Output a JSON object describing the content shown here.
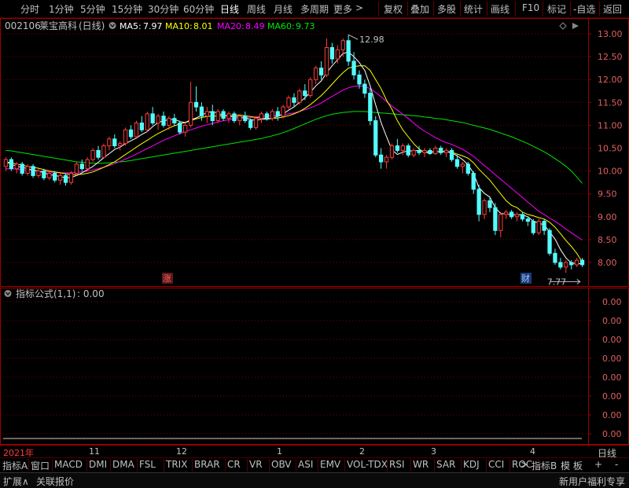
{
  "toolbar": {
    "periods": [
      "分时",
      "1分钟",
      "5分钟",
      "15分钟",
      "30分钟",
      "60分钟",
      "日线",
      "周线",
      "月线",
      "多周期",
      "更多"
    ],
    "active_period": "日线",
    "more_arrow": ">",
    "right_buttons": [
      "复权",
      "叠加",
      "多股",
      "统计",
      "画线",
      "F10",
      "标记",
      "-自选",
      "返回"
    ]
  },
  "header": {
    "code": "002106",
    "name": "莱宝高科",
    "period_label": "(日线)",
    "ma5_label": "MA5:",
    "ma5_value": "7.97",
    "ma10_label": "MA10:",
    "ma10_value": "8.01",
    "ma20_label": "MA20:",
    "ma20_value": "8.49",
    "ma60_label": "MA60:",
    "ma60_value": "9.73"
  },
  "colors": {
    "up": "#ff3c3c",
    "down": "#54fcfc",
    "ma5": "#ffffff",
    "ma10": "#ffff00",
    "ma20": "#ff00ff",
    "ma60": "#00e600",
    "frame": "#a00000"
  },
  "indicator": {
    "title": "指标公式(1,1)",
    "value": ": 0.00"
  },
  "chart_data": {
    "type": "candlestick",
    "y_ticks": [
      13.0,
      12.5,
      12.0,
      11.5,
      11.0,
      10.5,
      10.0,
      9.5,
      9.0,
      8.5,
      8.0
    ],
    "ylim": [
      7.65,
      13.15
    ],
    "high_marker": "12.98",
    "low_marker": "7.77",
    "markers": [
      "涨",
      "财"
    ],
    "x_labels": [
      "2021年",
      "11",
      "12",
      "1",
      "2",
      "3",
      "4"
    ],
    "ohlc": [
      [
        10.1,
        10.3,
        10.0,
        10.25
      ],
      [
        10.25,
        10.3,
        10.0,
        10.05
      ],
      [
        10.05,
        10.2,
        9.95,
        10.15
      ],
      [
        10.15,
        10.2,
        9.9,
        9.95
      ],
      [
        9.95,
        10.15,
        9.9,
        10.1
      ],
      [
        10.1,
        10.15,
        9.85,
        9.9
      ],
      [
        9.9,
        10.05,
        9.85,
        10.0
      ],
      [
        10.0,
        10.05,
        9.8,
        9.85
      ],
      [
        9.85,
        10.0,
        9.8,
        9.95
      ],
      [
        9.95,
        10.0,
        9.75,
        9.8
      ],
      [
        9.8,
        9.95,
        9.7,
        9.9
      ],
      [
        9.9,
        9.95,
        9.68,
        9.75
      ],
      [
        9.75,
        10.0,
        9.7,
        9.95
      ],
      [
        9.95,
        10.2,
        9.9,
        10.15
      ],
      [
        10.15,
        10.25,
        10.0,
        10.05
      ],
      [
        10.05,
        10.3,
        10.0,
        10.25
      ],
      [
        10.25,
        10.5,
        10.2,
        10.45
      ],
      [
        10.45,
        10.55,
        10.25,
        10.3
      ],
      [
        10.3,
        10.6,
        10.28,
        10.55
      ],
      [
        10.55,
        10.75,
        10.45,
        10.7
      ],
      [
        10.7,
        10.8,
        10.5,
        10.55
      ],
      [
        10.55,
        10.65,
        10.45,
        10.6
      ],
      [
        10.6,
        10.95,
        10.55,
        10.9
      ],
      [
        10.9,
        11.0,
        10.7,
        10.75
      ],
      [
        10.75,
        11.1,
        10.7,
        11.05
      ],
      [
        11.05,
        11.2,
        10.85,
        10.9
      ],
      [
        10.9,
        11.3,
        10.85,
        11.25
      ],
      [
        11.25,
        11.4,
        11.0,
        11.05
      ],
      [
        11.05,
        11.25,
        10.9,
        11.2
      ],
      [
        11.2,
        11.3,
        10.95,
        11.0
      ],
      [
        11.0,
        11.2,
        10.9,
        11.15
      ],
      [
        11.15,
        11.25,
        11.0,
        11.05
      ],
      [
        11.05,
        11.1,
        10.8,
        10.85
      ],
      [
        10.85,
        11.05,
        10.75,
        11.0
      ],
      [
        11.0,
        11.95,
        10.95,
        11.5
      ],
      [
        11.5,
        11.85,
        11.3,
        11.4
      ],
      [
        11.4,
        11.5,
        11.1,
        11.2
      ],
      [
        11.2,
        11.4,
        11.05,
        11.3
      ],
      [
        11.3,
        11.45,
        11.0,
        11.1
      ],
      [
        11.1,
        11.35,
        11.05,
        11.3
      ],
      [
        11.3,
        11.35,
        11.1,
        11.15
      ],
      [
        11.15,
        11.3,
        11.05,
        11.25
      ],
      [
        11.25,
        11.3,
        11.05,
        11.1
      ],
      [
        11.1,
        11.25,
        11.0,
        11.2
      ],
      [
        11.2,
        11.3,
        11.05,
        11.1
      ],
      [
        11.1,
        11.15,
        10.9,
        10.95
      ],
      [
        10.95,
        11.2,
        10.9,
        11.15
      ],
      [
        11.15,
        11.3,
        11.05,
        11.25
      ],
      [
        11.25,
        11.3,
        11.1,
        11.15
      ],
      [
        11.15,
        11.35,
        11.1,
        11.3
      ],
      [
        11.3,
        11.4,
        11.1,
        11.2
      ],
      [
        11.2,
        11.45,
        11.15,
        11.4
      ],
      [
        11.4,
        11.65,
        11.35,
        11.6
      ],
      [
        11.6,
        11.7,
        11.4,
        11.5
      ],
      [
        11.5,
        11.8,
        11.45,
        11.75
      ],
      [
        11.75,
        11.9,
        11.55,
        11.65
      ],
      [
        11.65,
        12.05,
        11.6,
        12.0
      ],
      [
        12.0,
        12.3,
        11.9,
        12.25
      ],
      [
        12.25,
        12.4,
        12.0,
        12.1
      ],
      [
        12.1,
        12.9,
        12.05,
        12.7
      ],
      [
        12.7,
        12.8,
        12.35,
        12.45
      ],
      [
        12.45,
        12.75,
        12.35,
        12.65
      ],
      [
        12.65,
        12.9,
        12.5,
        12.85
      ],
      [
        12.85,
        12.98,
        12.3,
        12.4
      ],
      [
        12.4,
        12.6,
        12.0,
        12.1
      ],
      [
        12.1,
        12.2,
        11.8,
        11.9
      ],
      [
        11.9,
        12.0,
        11.6,
        11.7
      ],
      [
        11.7,
        11.8,
        11.0,
        11.1
      ],
      [
        11.1,
        11.2,
        10.3,
        10.35
      ],
      [
        10.35,
        10.5,
        10.05,
        10.2
      ],
      [
        10.2,
        10.35,
        10.05,
        10.3
      ],
      [
        10.3,
        10.6,
        10.25,
        10.55
      ],
      [
        10.55,
        10.7,
        10.4,
        10.45
      ],
      [
        10.45,
        10.6,
        10.35,
        10.55
      ],
      [
        10.55,
        10.6,
        10.3,
        10.35
      ],
      [
        10.35,
        10.5,
        10.3,
        10.45
      ],
      [
        10.45,
        10.55,
        10.35,
        10.4
      ],
      [
        10.4,
        10.5,
        10.3,
        10.45
      ],
      [
        10.45,
        10.5,
        10.35,
        10.38
      ],
      [
        10.38,
        10.55,
        10.35,
        10.5
      ],
      [
        10.5,
        10.55,
        10.35,
        10.4
      ],
      [
        10.4,
        10.5,
        10.3,
        10.45
      ],
      [
        10.45,
        10.5,
        10.2,
        10.25
      ],
      [
        10.25,
        10.35,
        10.05,
        10.1
      ],
      [
        10.1,
        10.2,
        9.95,
        10.15
      ],
      [
        10.15,
        10.2,
        9.9,
        9.95
      ],
      [
        9.95,
        10.0,
        9.5,
        9.6
      ],
      [
        9.6,
        9.7,
        8.9,
        9.05
      ],
      [
        9.05,
        9.4,
        8.95,
        9.35
      ],
      [
        9.35,
        9.45,
        9.1,
        9.2
      ],
      [
        9.2,
        9.3,
        8.6,
        8.7
      ],
      [
        8.7,
        9.1,
        8.55,
        9.05
      ],
      [
        9.05,
        9.15,
        8.95,
        9.1
      ],
      [
        9.1,
        9.15,
        8.95,
        9.0
      ],
      [
        9.0,
        9.1,
        8.9,
        9.05
      ],
      [
        9.05,
        9.1,
        8.9,
        8.95
      ],
      [
        8.95,
        9.0,
        8.8,
        8.9
      ],
      [
        8.9,
        8.95,
        8.6,
        8.65
      ],
      [
        8.65,
        8.95,
        8.6,
        8.9
      ],
      [
        8.9,
        8.95,
        8.6,
        8.7
      ],
      [
        8.7,
        8.75,
        8.15,
        8.2
      ],
      [
        8.2,
        8.3,
        7.95,
        8.0
      ],
      [
        8.0,
        8.1,
        7.85,
        7.9
      ],
      [
        7.9,
        8.05,
        7.77,
        8.0
      ],
      [
        8.0,
        8.05,
        7.85,
        7.95
      ],
      [
        7.95,
        8.1,
        7.9,
        8.05
      ],
      [
        8.05,
        8.1,
        7.9,
        7.95
      ]
    ],
    "ma5": [
      10.2,
      10.15,
      10.1,
      10.08,
      10.05,
      10.02,
      10.0,
      9.96,
      9.92,
      9.9,
      9.88,
      9.85,
      9.86,
      9.9,
      9.96,
      10.03,
      10.1,
      10.19,
      10.29,
      10.38,
      10.47,
      10.52,
      10.6,
      10.66,
      10.72,
      10.8,
      10.86,
      10.97,
      11.06,
      11.1,
      11.12,
      11.13,
      11.08,
      11.06,
      11.12,
      11.16,
      11.22,
      11.28,
      11.3,
      11.26,
      11.22,
      11.2,
      11.18,
      11.18,
      11.17,
      11.12,
      11.11,
      11.13,
      11.13,
      11.15,
      11.2,
      11.25,
      11.33,
      11.4,
      11.5,
      11.6,
      11.72,
      11.86,
      11.97,
      12.15,
      12.3,
      12.43,
      12.57,
      12.6,
      12.5,
      12.37,
      12.2,
      11.86,
      11.45,
      11.06,
      10.75,
      10.46,
      10.36,
      10.41,
      10.44,
      10.44,
      10.45,
      10.42,
      10.42,
      10.42,
      10.43,
      10.42,
      10.4,
      10.33,
      10.25,
      10.14,
      9.95,
      9.64,
      9.51,
      9.43,
      9.2,
      9.07,
      9.06,
      9.04,
      9.05,
      9.04,
      9.0,
      8.9,
      8.86,
      8.82,
      8.67,
      8.51,
      8.28,
      8.1,
      7.99,
      7.98,
      7.97
    ],
    "ma10": [
      10.2,
      10.18,
      10.15,
      10.13,
      10.1,
      10.08,
      10.06,
      10.03,
      10.0,
      9.98,
      9.96,
      9.94,
      9.92,
      9.92,
      9.93,
      9.95,
      9.98,
      10.03,
      10.08,
      10.14,
      10.2,
      10.28,
      10.36,
      10.44,
      10.52,
      10.6,
      10.67,
      10.75,
      10.82,
      10.88,
      10.94,
      10.99,
      11.03,
      11.06,
      11.1,
      11.14,
      11.17,
      11.19,
      11.2,
      11.2,
      11.21,
      11.21,
      11.22,
      11.22,
      11.21,
      11.19,
      11.17,
      11.16,
      11.15,
      11.15,
      11.16,
      11.18,
      11.21,
      11.25,
      11.3,
      11.37,
      11.45,
      11.55,
      11.65,
      11.77,
      11.9,
      12.03,
      12.15,
      12.25,
      12.28,
      12.3,
      12.3,
      12.2,
      12.0,
      11.8,
      11.55,
      11.35,
      11.1,
      10.9,
      10.75,
      10.6,
      10.48,
      10.4,
      10.41,
      10.42,
      10.43,
      10.43,
      10.41,
      10.37,
      10.33,
      10.28,
      10.18,
      10.04,
      9.92,
      9.8,
      9.65,
      9.5,
      9.35,
      9.25,
      9.2,
      9.1,
      9.05,
      9.02,
      8.98,
      8.95,
      8.88,
      8.77,
      8.63,
      8.48,
      8.35,
      8.2,
      8.01
    ],
    "ma20": [
      10.05,
      10.05,
      10.04,
      10.03,
      10.02,
      10.01,
      10.0,
      9.99,
      9.98,
      9.97,
      9.96,
      9.96,
      9.96,
      9.97,
      9.98,
      10.0,
      10.02,
      10.05,
      10.08,
      10.12,
      10.16,
      10.21,
      10.26,
      10.31,
      10.37,
      10.43,
      10.49,
      10.55,
      10.61,
      10.67,
      10.72,
      10.77,
      10.82,
      10.86,
      10.9,
      10.94,
      10.98,
      11.01,
      11.04,
      11.07,
      11.1,
      11.12,
      11.14,
      11.15,
      11.16,
      11.17,
      11.18,
      11.19,
      11.2,
      11.21,
      11.22,
      11.23,
      11.25,
      11.27,
      11.3,
      11.34,
      11.38,
      11.43,
      11.49,
      11.56,
      11.63,
      11.7,
      11.77,
      11.82,
      11.85,
      11.86,
      11.85,
      11.8,
      11.72,
      11.62,
      11.52,
      11.42,
      11.33,
      11.24,
      11.15,
      11.05,
      10.95,
      10.87,
      10.8,
      10.73,
      10.67,
      10.62,
      10.58,
      10.53,
      10.47,
      10.4,
      10.32,
      10.22,
      10.12,
      10.02,
      9.92,
      9.82,
      9.72,
      9.62,
      9.52,
      9.42,
      9.32,
      9.22,
      9.12,
      9.05,
      8.97,
      8.9,
      8.82,
      8.73,
      8.65,
      8.57,
      8.49
    ],
    "ma60": [
      10.45,
      10.44,
      10.42,
      10.4,
      10.38,
      10.36,
      10.34,
      10.32,
      10.3,
      10.28,
      10.26,
      10.24,
      10.22,
      10.2,
      10.19,
      10.18,
      10.17,
      10.17,
      10.17,
      10.18,
      10.19,
      10.2,
      10.21,
      10.23,
      10.25,
      10.27,
      10.29,
      10.31,
      10.33,
      10.35,
      10.37,
      10.39,
      10.41,
      10.43,
      10.45,
      10.47,
      10.49,
      10.51,
      10.53,
      10.55,
      10.57,
      10.59,
      10.61,
      10.63,
      10.65,
      10.67,
      10.69,
      10.71,
      10.74,
      10.77,
      10.8,
      10.84,
      10.88,
      10.93,
      10.98,
      11.03,
      11.08,
      11.13,
      11.17,
      11.21,
      11.24,
      11.26,
      11.28,
      11.29,
      11.3,
      11.3,
      11.3,
      11.29,
      11.28,
      11.27,
      11.26,
      11.25,
      11.24,
      11.23,
      11.22,
      11.21,
      11.2,
      11.18,
      11.17,
      11.15,
      11.14,
      11.12,
      11.1,
      11.08,
      11.06,
      11.03,
      11.0,
      10.97,
      10.94,
      10.91,
      10.87,
      10.83,
      10.79,
      10.75,
      10.7,
      10.65,
      10.6,
      10.54,
      10.48,
      10.42,
      10.35,
      10.27,
      10.19,
      10.1,
      10.0,
      9.87,
      9.73
    ],
    "indicator_y_ticks": [
      "0.00",
      "0.00",
      "0.00",
      "0.00",
      "0.00",
      "0.00",
      "0.00",
      "0.00"
    ]
  },
  "xaxis": {
    "period_button": "日线"
  },
  "tabs": [
    "指标A",
    "窗口",
    "MACD",
    "DMI",
    "DMA",
    "FSL",
    "TRIX",
    "BRAR",
    "CR",
    "VR",
    "OBV",
    "ASI",
    "EMV",
    "VOL-TDX",
    "RSI",
    "WR",
    "SAR",
    "KDJ",
    "CCI",
    "ROC"
  ],
  "tabs_more": ">",
  "tab_right": {
    "b": "指标B",
    "mode": "模 板",
    "plus": "+",
    "minus": "-"
  },
  "status": {
    "expand": "扩展∧",
    "related": "关联报价",
    "promo": "新用户福利专享"
  }
}
